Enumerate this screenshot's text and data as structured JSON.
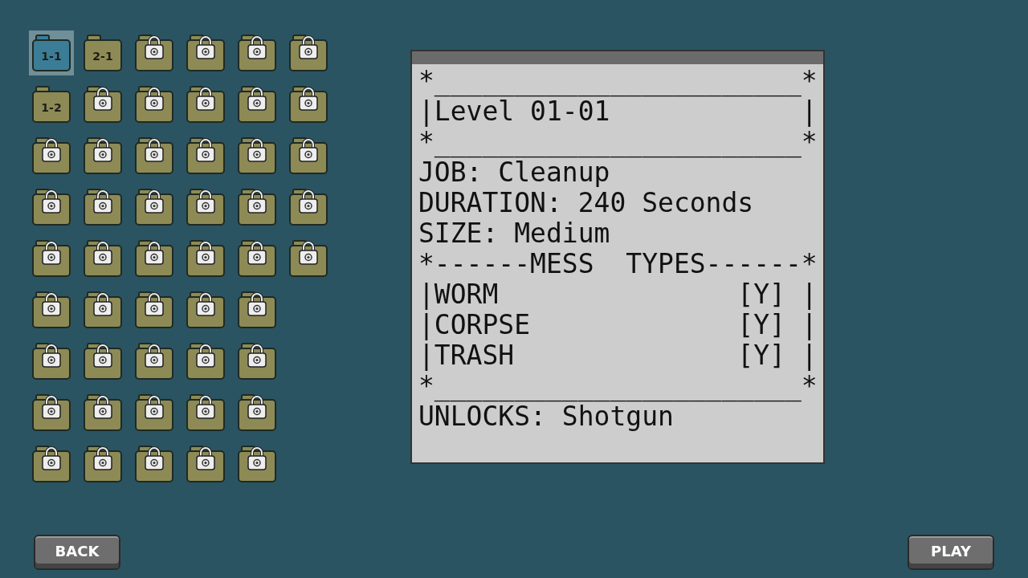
{
  "levels": [
    {
      "label": "1-1",
      "locked": false,
      "selected": true
    },
    {
      "label": "2-1",
      "locked": false,
      "selected": false
    },
    {
      "locked": true,
      "selected": false
    },
    {
      "locked": true,
      "selected": false
    },
    {
      "locked": true,
      "selected": false
    },
    {
      "locked": true,
      "selected": false
    },
    {
      "label": "1-2",
      "locked": false,
      "selected": false
    },
    {
      "locked": true,
      "selected": false
    },
    {
      "locked": true,
      "selected": false
    },
    {
      "locked": true,
      "selected": false
    },
    {
      "locked": true,
      "selected": false
    },
    {
      "locked": true,
      "selected": false
    },
    {
      "locked": true,
      "selected": false
    },
    {
      "locked": true,
      "selected": false
    },
    {
      "locked": true,
      "selected": false
    },
    {
      "locked": true,
      "selected": false
    },
    {
      "locked": true,
      "selected": false
    },
    {
      "locked": true,
      "selected": false
    },
    {
      "locked": true,
      "selected": false
    },
    {
      "locked": true,
      "selected": false
    },
    {
      "locked": true,
      "selected": false
    },
    {
      "locked": true,
      "selected": false
    },
    {
      "locked": true,
      "selected": false
    },
    {
      "locked": true,
      "selected": false
    },
    {
      "locked": true,
      "selected": false
    },
    {
      "locked": true,
      "selected": false
    },
    {
      "locked": true,
      "selected": false
    },
    {
      "locked": true,
      "selected": false
    },
    {
      "locked": true,
      "selected": false
    },
    {
      "locked": true,
      "selected": false
    },
    {
      "locked": true,
      "selected": false
    },
    {
      "locked": true,
      "selected": false
    },
    {
      "locked": true,
      "selected": false
    },
    {
      "locked": true,
      "selected": false
    },
    {
      "locked": true,
      "selected": false
    },
    {
      "locked": true,
      "selected": false
    },
    {
      "locked": true,
      "selected": false
    },
    {
      "locked": true,
      "selected": false
    },
    {
      "locked": true,
      "selected": false
    },
    {
      "locked": true,
      "selected": false
    },
    {
      "locked": true,
      "selected": false
    },
    {
      "locked": true,
      "selected": false
    },
    {
      "locked": true,
      "selected": false
    },
    {
      "locked": true,
      "selected": false
    },
    {
      "locked": true,
      "selected": false
    },
    {
      "locked": true,
      "selected": false
    },
    {
      "locked": true,
      "selected": false
    },
    {
      "locked": true,
      "selected": false
    },
    {
      "locked": true,
      "selected": false
    },
    {
      "locked": true,
      "selected": false
    }
  ],
  "briefing": {
    "lines": [
      "*_______________________*",
      "|Level 01-01            |",
      "*_______________________*",
      "JOB: Cleanup",
      "DURATION: 240 Seconds",
      "SIZE: Medium",
      "*------MESS  TYPES------*",
      "|WORM               [Y] |",
      "|CORPSE             [Y] |",
      "|TRASH              [Y] |",
      "*_______________________*",
      "UNLOCKS: Shotgun"
    ]
  },
  "buttons": {
    "back": "BACK",
    "play": "PLAY"
  }
}
